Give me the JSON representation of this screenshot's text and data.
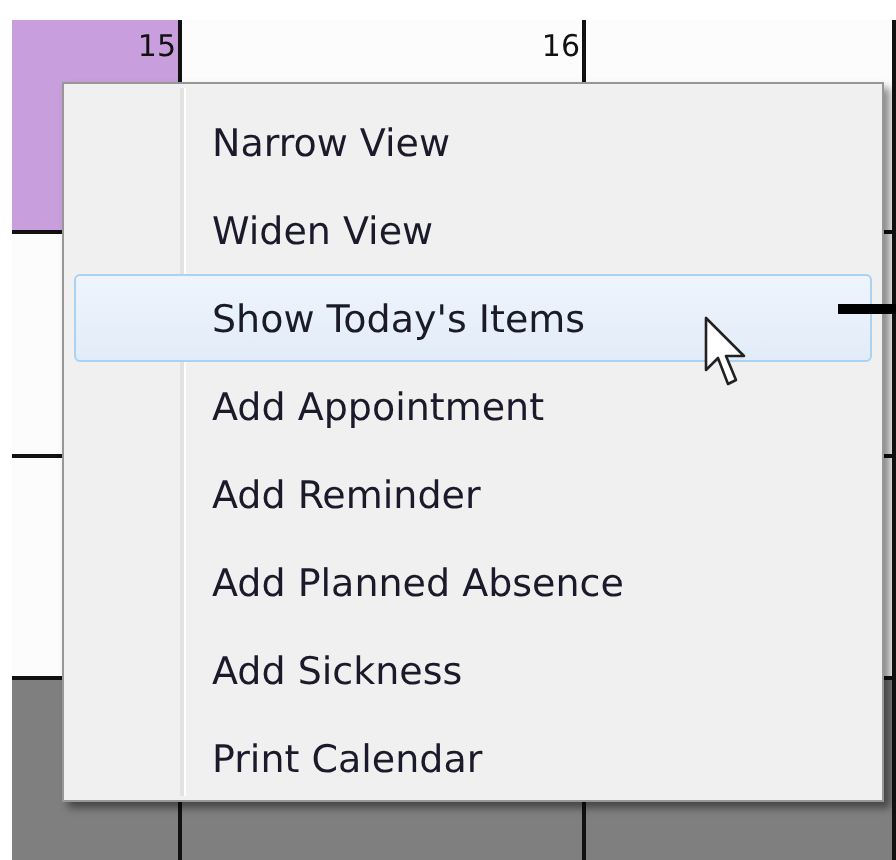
{
  "calendar": {
    "days": [
      {
        "label": "15",
        "selected": true
      },
      {
        "label": "16",
        "selected": false
      }
    ]
  },
  "context_menu": {
    "items": [
      {
        "label": "Narrow View",
        "selected": false
      },
      {
        "label": "Widen View",
        "selected": false
      },
      {
        "label": "Show Today's Items",
        "selected": true
      },
      {
        "label": "Add Appointment",
        "selected": false
      },
      {
        "label": "Add Reminder",
        "selected": false
      },
      {
        "label": "Add Planned Absence",
        "selected": false
      },
      {
        "label": "Add Sickness",
        "selected": false
      },
      {
        "label": "Print Calendar",
        "selected": false
      }
    ]
  }
}
